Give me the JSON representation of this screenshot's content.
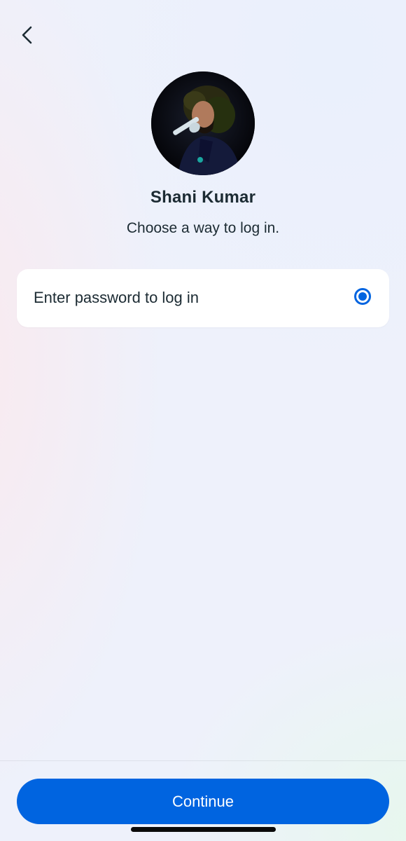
{
  "header": {
    "back_icon": "chevron-left-icon"
  },
  "profile": {
    "name": "Shani Kumar",
    "subtitle": "Choose a way to log in."
  },
  "options": [
    {
      "label": "Enter password to log in",
      "selected": true
    }
  ],
  "footer": {
    "continue_label": "Continue"
  },
  "colors": {
    "primary": "#0064e0",
    "text": "#1c2b33",
    "card": "#ffffff"
  }
}
